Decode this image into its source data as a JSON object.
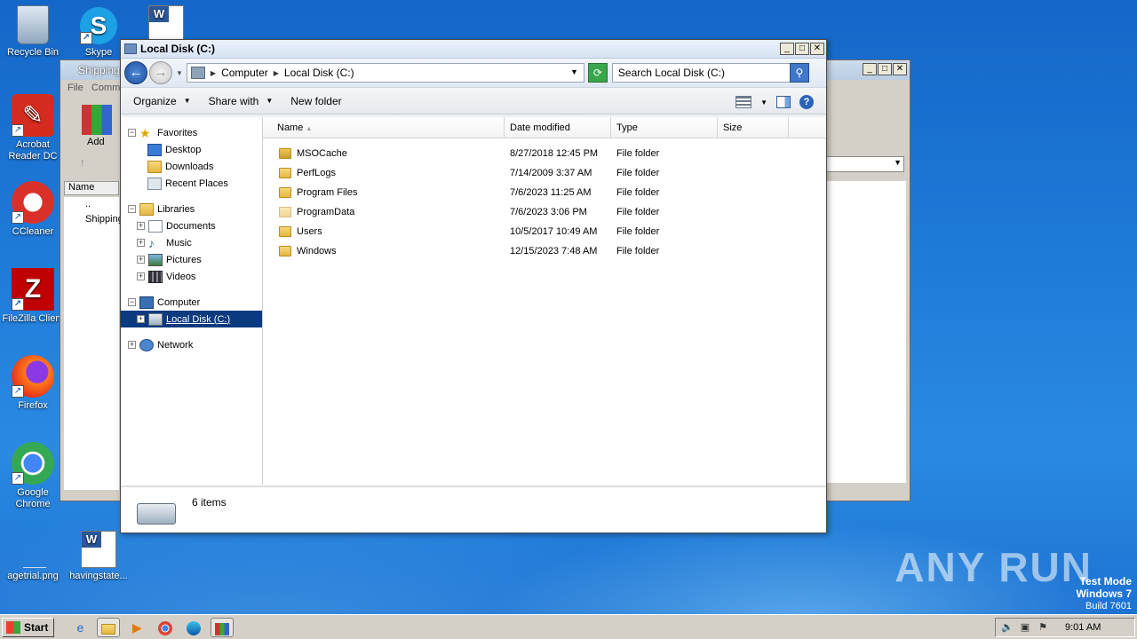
{
  "desktop": {
    "icons": [
      {
        "label": "Recycle Bin"
      },
      {
        "label": "Skype"
      },
      {
        "label": "Acrobat Reader DC"
      },
      {
        "label": "CCleaner"
      },
      {
        "label": "FileZilla Client"
      },
      {
        "label": "Firefox"
      },
      {
        "label": "Google Chrome"
      },
      {
        "label": "agetrial.png"
      },
      {
        "label": "havingstate..."
      }
    ],
    "watermark": "ANY RUN",
    "test_mode": {
      "line1": "Test Mode",
      "line2": "Windows 7",
      "line3": "Build 7601"
    }
  },
  "back_window": {
    "title": "Shipping",
    "menu_file": "File",
    "menu_comm": "Comm",
    "add_label": "Add",
    "col_name": "Name",
    "rows": [
      "..",
      "Shipping"
    ]
  },
  "window": {
    "title": "Local Disk (C:)",
    "breadcrumb": [
      "Computer",
      "Local Disk (C:)"
    ],
    "search_placeholder": "Search Local Disk (C:)",
    "toolbar": {
      "organize": "Organize",
      "share_with": "Share with",
      "new_folder": "New folder"
    },
    "nav": {
      "favorites": "Favorites",
      "fav_items": [
        "Desktop",
        "Downloads",
        "Recent Places"
      ],
      "libraries": "Libraries",
      "lib_items": [
        "Documents",
        "Music",
        "Pictures",
        "Videos"
      ],
      "computer": "Computer",
      "local_disk": "Local Disk (C:)",
      "network": "Network"
    },
    "columns": {
      "name": "Name",
      "date": "Date modified",
      "type": "Type",
      "size": "Size"
    },
    "files": [
      {
        "name": "MSOCache",
        "date": "8/27/2018 12:45 PM",
        "type": "File folder"
      },
      {
        "name": "PerfLogs",
        "date": "7/14/2009 3:37 AM",
        "type": "File folder"
      },
      {
        "name": "Program Files",
        "date": "7/6/2023 11:25 AM",
        "type": "File folder"
      },
      {
        "name": "ProgramData",
        "date": "7/6/2023 3:06 PM",
        "type": "File folder"
      },
      {
        "name": "Users",
        "date": "10/5/2017 10:49 AM",
        "type": "File folder"
      },
      {
        "name": "Windows",
        "date": "12/15/2023 7:48 AM",
        "type": "File folder"
      }
    ],
    "item_count": "6 items"
  },
  "taskbar": {
    "start": "Start",
    "clock": "9:01 AM"
  }
}
